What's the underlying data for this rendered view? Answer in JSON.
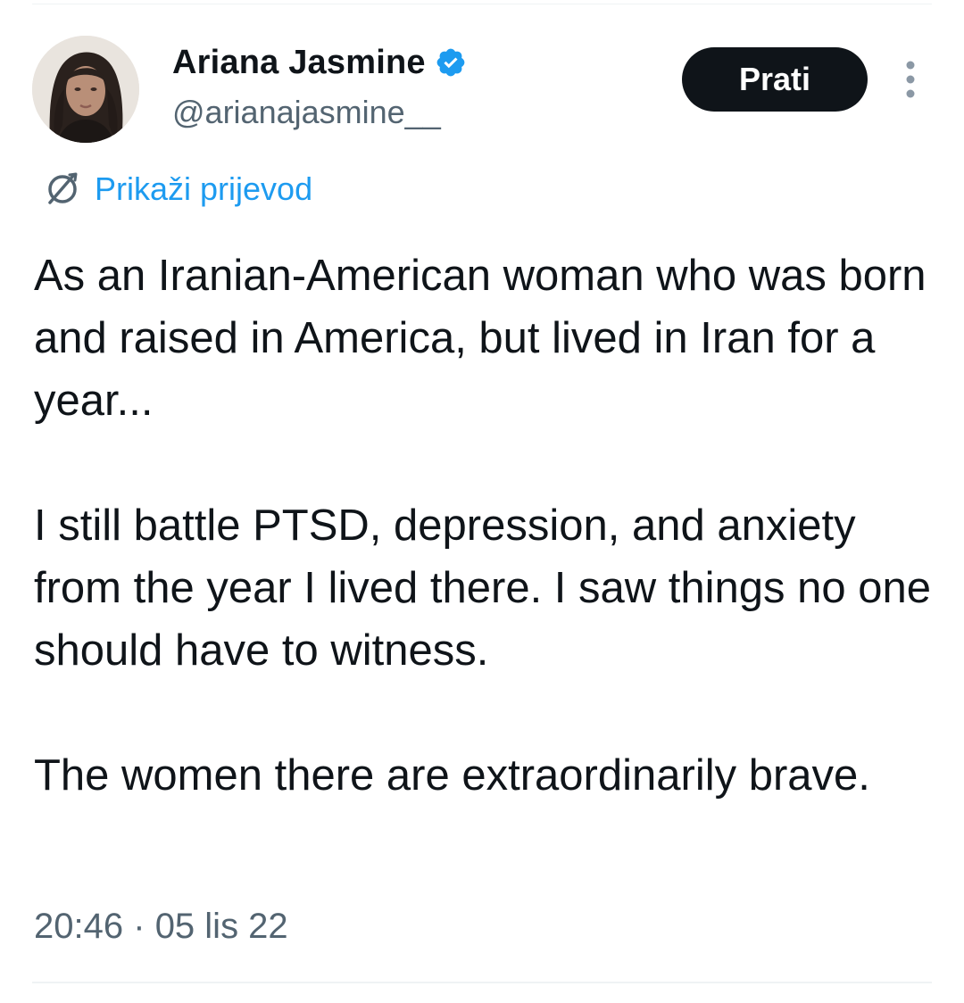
{
  "user": {
    "display_name": "Ariana Jasmine",
    "handle": "@arianajasmine__",
    "verified": true,
    "verified_icon": "verified-badge-icon",
    "avatar_icon": "avatar"
  },
  "actions": {
    "follow_label": "Prati",
    "more_icon": "more-vertical-icon"
  },
  "translate": {
    "icon": "globe-icon",
    "label": "Prikaži prijevod"
  },
  "tweet": {
    "paragraphs": [
      "As an Iranian-American woman who was born and raised in America, but lived in Iran for a year...",
      "I still battle PTSD, depression, and anxiety from the year I lived there. I saw things no one should have to witness.",
      "The women there are extraordinarily brave."
    ],
    "time": "20:46",
    "date": "05 lis 22",
    "meta_separator": "·"
  },
  "colors": {
    "text_primary": "#0f1419",
    "text_secondary": "#536471",
    "link_blue": "#1d9bf0",
    "button_bg": "#0f1419",
    "button_text": "#ffffff",
    "divider": "#eff3f4"
  }
}
